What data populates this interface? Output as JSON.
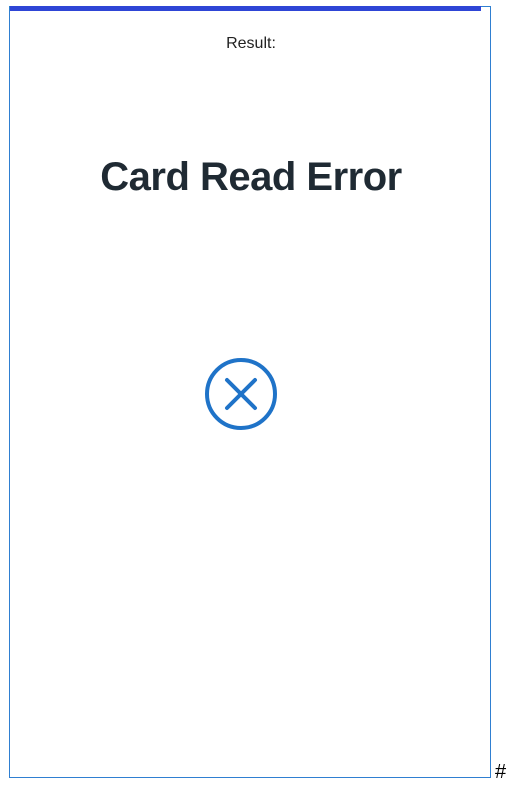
{
  "result": {
    "label": "Result:",
    "title": "Card Read Error",
    "icon": "close-circle-icon"
  },
  "colors": {
    "accent_bar": "#2e45d6",
    "frame_border": "#2f7fd1",
    "icon": "#1f73c8",
    "title": "#1f2a33"
  },
  "corner_mark": "#"
}
